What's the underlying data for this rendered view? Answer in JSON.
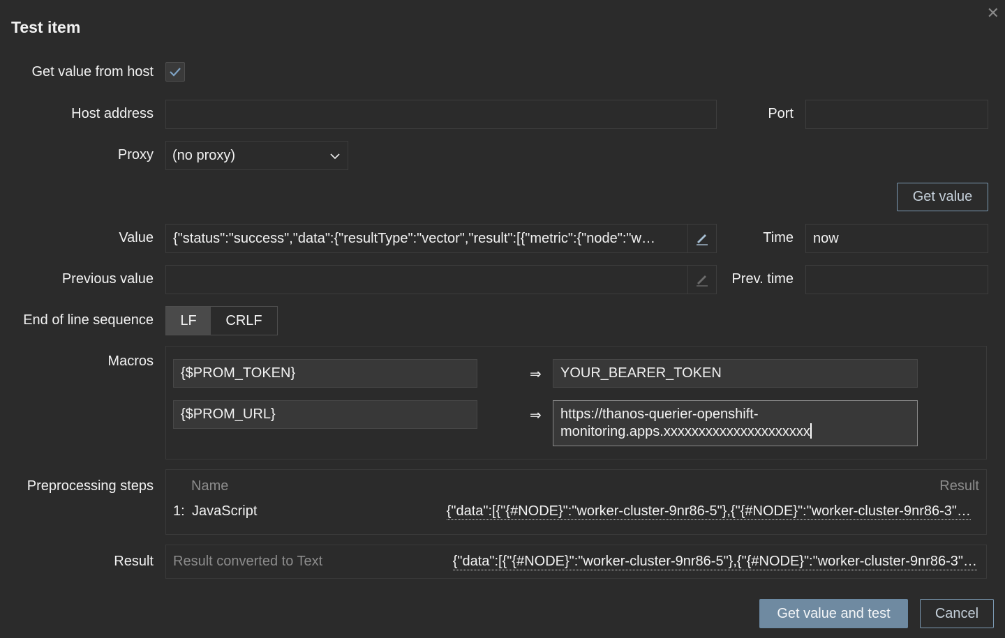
{
  "dialog": {
    "title": "Test item",
    "close_icon": "close-icon"
  },
  "form": {
    "get_value_from_host_label": "Get value from host",
    "get_value_from_host_checked": true,
    "host_address_label": "Host address",
    "host_address_value": "",
    "port_label": "Port",
    "port_value": "",
    "proxy_label": "Proxy",
    "proxy_value": "(no proxy)",
    "get_value_button": "Get value",
    "value_label": "Value",
    "value_value": "{\"status\":\"success\",\"data\":{\"resultType\":\"vector\",\"result\":[{\"metric\":{\"node\":\"w…",
    "time_label": "Time",
    "time_value": "now",
    "previous_value_label": "Previous value",
    "previous_value_value": "",
    "prev_time_label": "Prev. time",
    "prev_time_value": "",
    "eol_label": "End of line sequence",
    "eol_options": [
      "LF",
      "CRLF"
    ],
    "eol_selected": "LF",
    "macros_label": "Macros",
    "macros": [
      {
        "name": "{$PROM_TOKEN}",
        "arrow": "⇒",
        "value": "YOUR_BEARER_TOKEN"
      },
      {
        "name": "{$PROM_URL}",
        "arrow": "⇒",
        "value_line1": "https://thanos-querier-openshift-",
        "value_line2": "monitoring.apps.xxxxxxxxxxxxxxxxxxxxx"
      }
    ],
    "preprocessing_label": "Preprocessing steps",
    "preprocessing_headers": {
      "name": "Name",
      "result": "Result"
    },
    "preprocessing_steps": [
      {
        "index": "1:",
        "name": "JavaScript",
        "result": "{\"data\":[{\"{#NODE}\":\"worker-cluster-9nr86-5\"},{\"{#NODE}\":\"worker-cluster-9nr86-3\"…"
      }
    ],
    "result_label": "Result",
    "result_placeholder": "Result converted to Text",
    "result_value": "{\"data\":[{\"{#NODE}\":\"worker-cluster-9nr86-5\"},{\"{#NODE}\":\"worker-cluster-9nr86-3\"…"
  },
  "footer": {
    "primary_button": "Get value and test",
    "cancel_button": "Cancel"
  },
  "colors": {
    "background": "#2b2b2b",
    "primary_button": "#6f8aa1",
    "outline_button_border": "#7c9bb4"
  }
}
